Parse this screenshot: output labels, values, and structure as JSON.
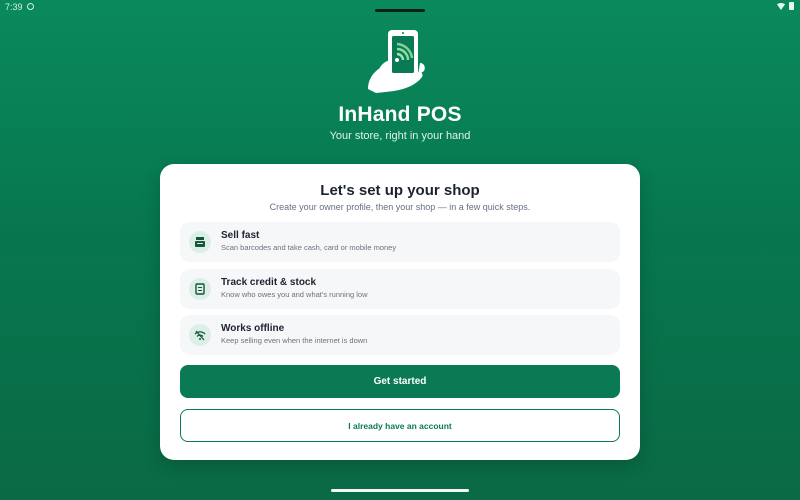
{
  "status": {
    "time": "7:39"
  },
  "app": {
    "title": "InHand POS",
    "tagline": "Your store, right in your hand"
  },
  "setup": {
    "title": "Let's set up your shop",
    "subtitle": "Create your owner profile, then your shop — in a few quick steps.",
    "features": [
      {
        "icon": "cash-register-icon",
        "title": "Sell fast",
        "description": "Scan barcodes and take cash, card or mobile money"
      },
      {
        "icon": "ledger-icon",
        "title": "Track credit & stock",
        "description": "Know who owes you and what's running low"
      },
      {
        "icon": "wifi-off-icon",
        "title": "Works offline",
        "description": "Keep selling even when the internet is down"
      }
    ],
    "primary_button": "Get started",
    "secondary_button": "I already have an account"
  },
  "colors": {
    "brand": "#0a7a54",
    "background_top": "#0a8a5c",
    "card": "#ffffff"
  }
}
